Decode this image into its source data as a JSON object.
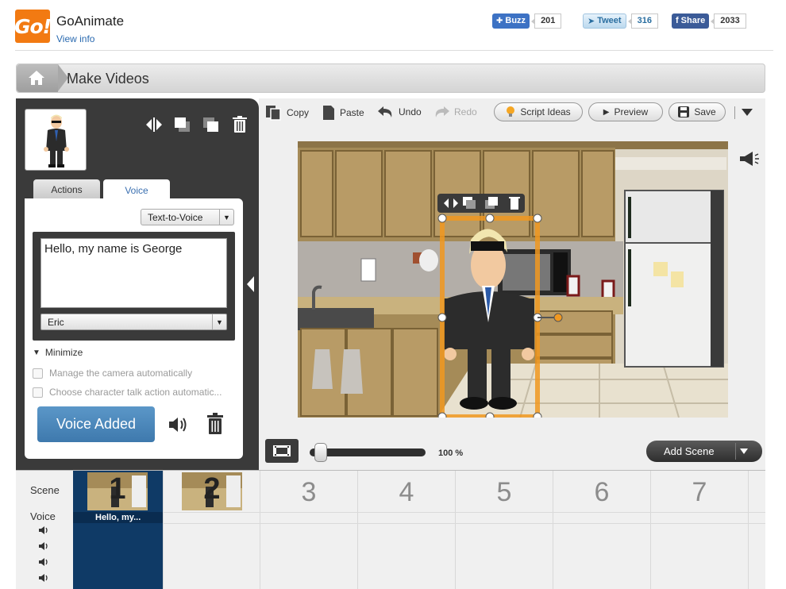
{
  "header": {
    "brand": "GoAnimate",
    "view_info": "View info",
    "logo_text": "Go!",
    "buzz": {
      "label": "Buzz",
      "count": "201"
    },
    "tweet": {
      "label": "Tweet",
      "count": "316"
    },
    "share": {
      "label": "Share",
      "count": "2033"
    }
  },
  "title": "Make Videos",
  "left_panel": {
    "tabs": [
      {
        "label": "Actions"
      },
      {
        "label": "Voice"
      }
    ],
    "tts_select": "Text-to-Voice",
    "voice_text": "Hello, my name is George",
    "voice_select": "Eric",
    "minimize": "Minimize",
    "checkbox_camera": "Manage the camera automatically",
    "checkbox_talk": "Choose character talk action automatic...",
    "voice_added": "Voice Added"
  },
  "toolbar": {
    "copy": "Copy",
    "paste": "Paste",
    "undo": "Undo",
    "redo": "Redo",
    "script_ideas": "Script Ideas",
    "preview": "Preview",
    "save": "Save"
  },
  "zoom": "100 %",
  "add_scene": "Add Scene",
  "timeline": {
    "scene_label": "Scene",
    "voice_label": "Voice",
    "scenes": [
      "1",
      "2",
      "3",
      "4",
      "5",
      "6",
      "7"
    ],
    "voice_chip": "Hello, my..."
  },
  "colors": {
    "accent_orange": "#f27a12",
    "voice_button": "#4a86bb",
    "timeline_selected": "#0f3a66",
    "dark_panel": "#3a3a3a"
  }
}
